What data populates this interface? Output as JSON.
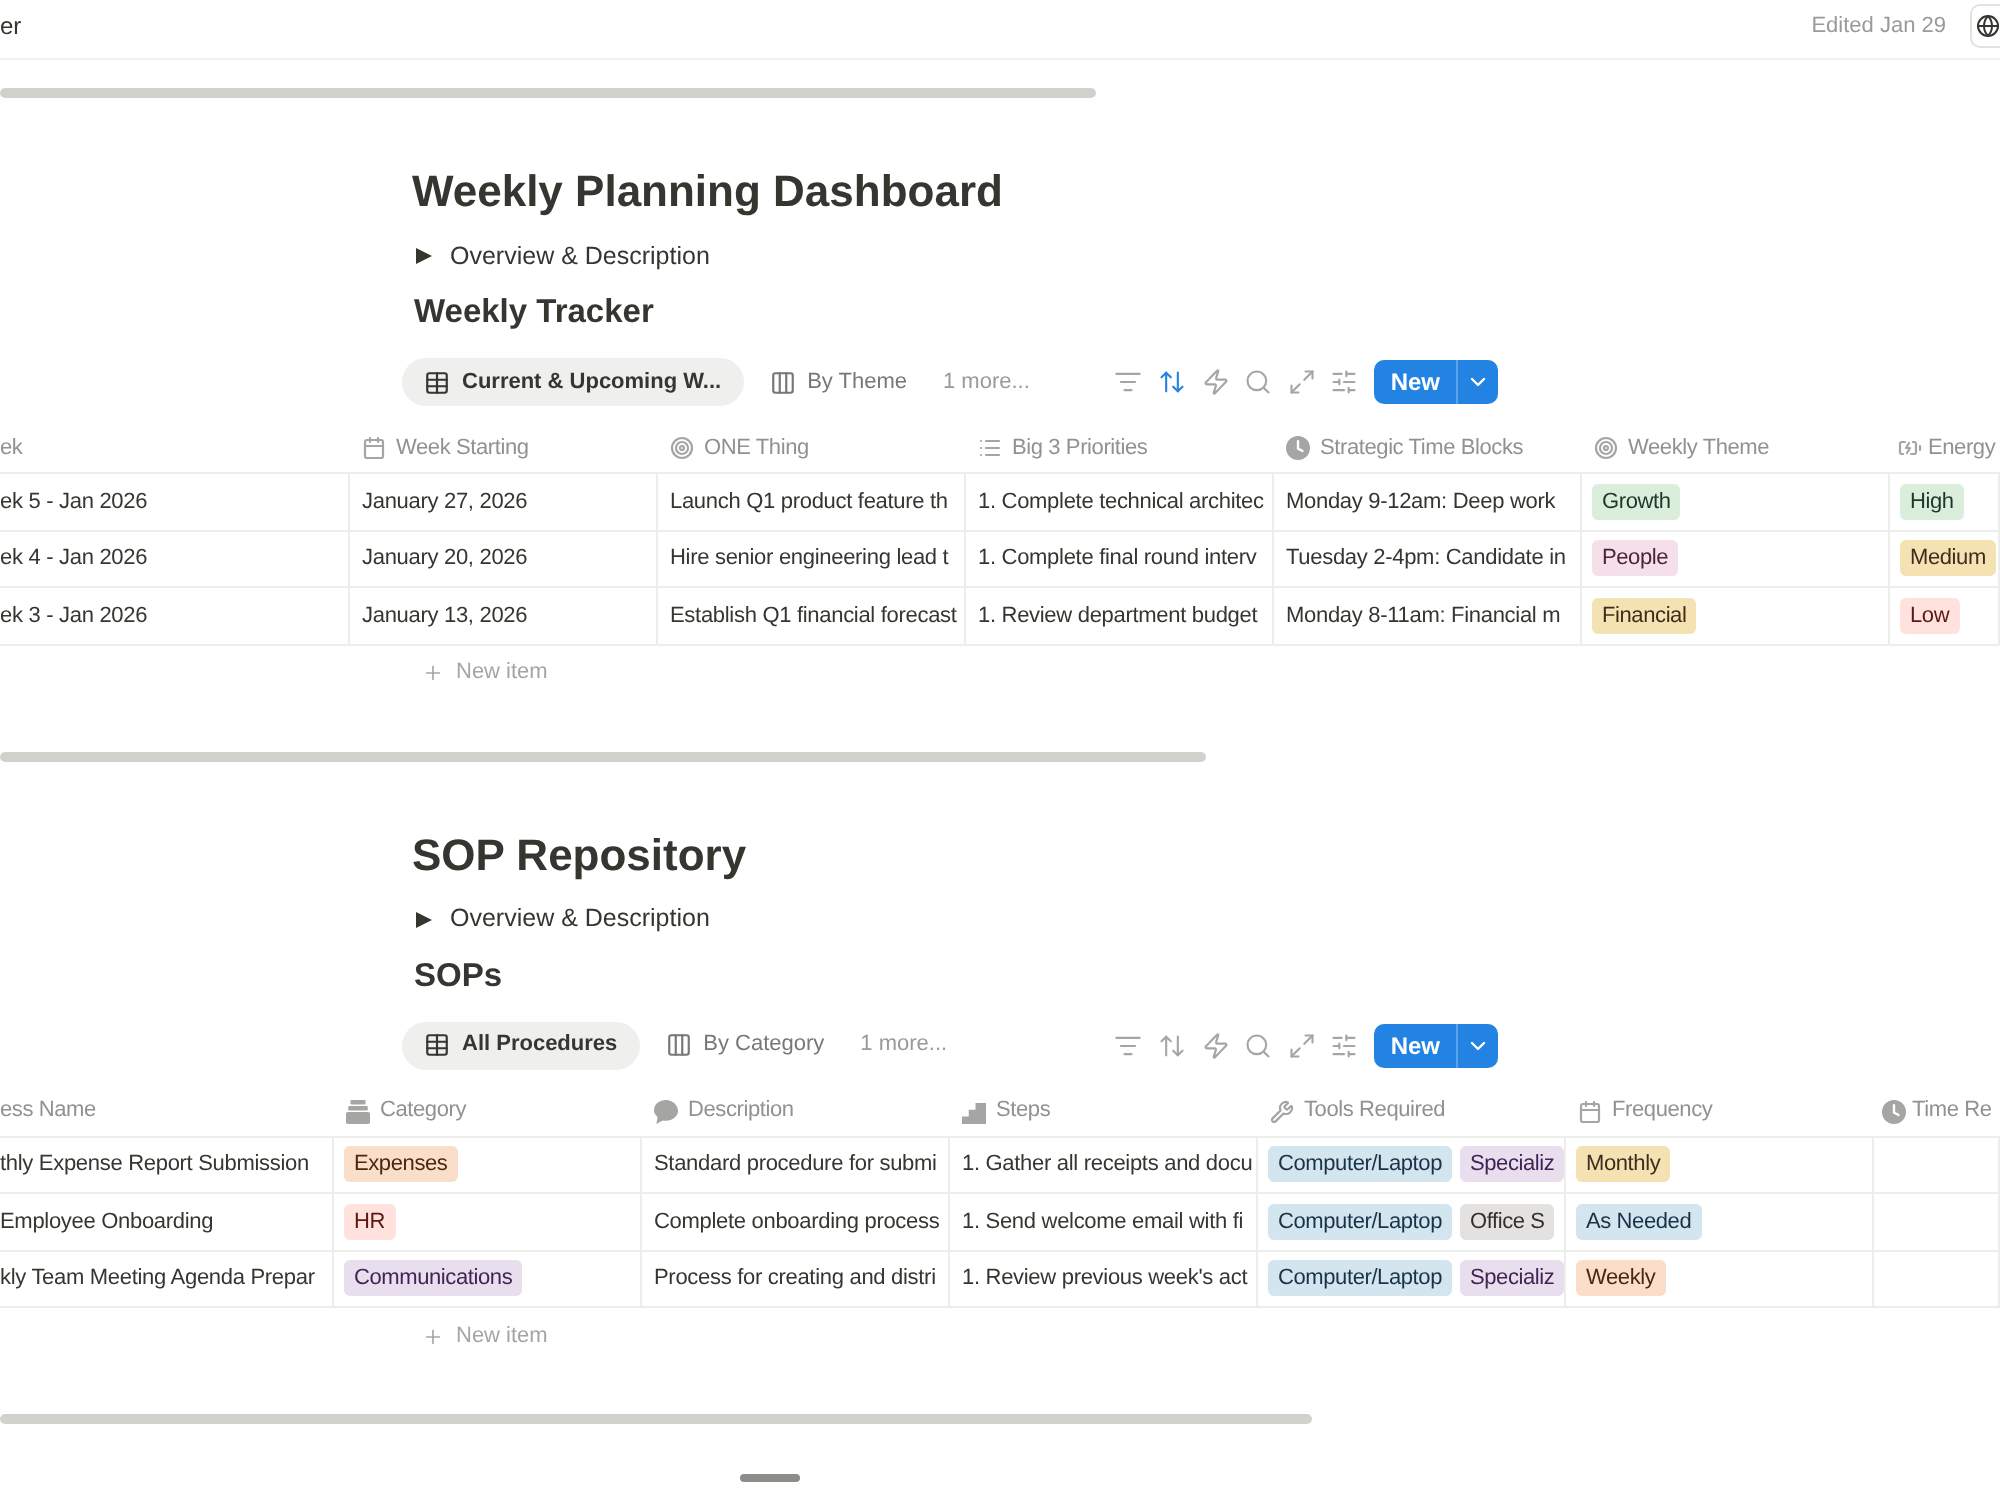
{
  "top_bar": {
    "breadcrumb": "er",
    "edited": "Edited Jan 29"
  },
  "sections": [
    {
      "title": "Weekly Planning Dashboard",
      "toggle": {
        "label": "Overview & Description",
        "expanded": false
      },
      "database_title": "Weekly Tracker",
      "views": [
        {
          "label": "Current & Upcoming W...",
          "kind": "table",
          "selected": true
        },
        {
          "label": "By Theme",
          "kind": "board",
          "selected": false
        }
      ],
      "more_views": "1 more...",
      "toolbar": {
        "sort_active": true,
        "new_button": "New"
      },
      "columns": [
        {
          "label": "ek",
          "kind": "title"
        },
        {
          "label": "Week Starting",
          "kind": "date"
        },
        {
          "label": "ONE Thing",
          "kind": "focus"
        },
        {
          "label": "Big 3 Priorities",
          "kind": "list"
        },
        {
          "label": "Strategic Time Blocks",
          "kind": "time"
        },
        {
          "label": "Weekly Theme",
          "kind": "focus"
        },
        {
          "label": "Energy",
          "kind": "energy"
        }
      ],
      "rows": [
        [
          {
            "text": "ek 5 - Jan 2026"
          },
          {
            "text": "January 27, 2026"
          },
          {
            "text": "Launch Q1 product feature th"
          },
          {
            "text": "1. Complete technical architec"
          },
          {
            "text": "Monday 9-12am: Deep work"
          },
          {
            "tags": [
              {
                "label": "Growth",
                "color": "#dbeddb"
              }
            ]
          },
          {
            "tags": [
              {
                "label": "High",
                "color": "#dbeddb"
              }
            ]
          }
        ],
        [
          {
            "text": "ek 4 - Jan 2026"
          },
          {
            "text": "January 20, 2026"
          },
          {
            "text": "Hire senior engineering lead t"
          },
          {
            "text": "1. Complete final round interv"
          },
          {
            "text": "Tuesday 2-4pm: Candidate in"
          },
          {
            "tags": [
              {
                "label": "People",
                "color": "#f5e0e9"
              }
            ]
          },
          {
            "tags": [
              {
                "label": "Medium",
                "color": "#f5e2b3"
              }
            ]
          }
        ],
        [
          {
            "text": "ek 3 - Jan 2026"
          },
          {
            "text": "January 13, 2026"
          },
          {
            "text": "Establish Q1 financial forecast"
          },
          {
            "text": "1. Review department budget"
          },
          {
            "text": "Monday 8-11am: Financial m"
          },
          {
            "tags": [
              {
                "label": "Financial",
                "color": "#f5e2b3"
              }
            ]
          },
          {
            "tags": [
              {
                "label": "Low",
                "color": "#ffe2dd"
              }
            ]
          }
        ]
      ],
      "new_item": "New item"
    },
    {
      "title": "SOP Repository",
      "toggle": {
        "label": "Overview & Description",
        "expanded": false
      },
      "database_title": "SOPs",
      "views": [
        {
          "label": "All Procedures",
          "kind": "table",
          "selected": true
        },
        {
          "label": "By Category",
          "kind": "board",
          "selected": false
        }
      ],
      "more_views": "1 more...",
      "toolbar": {
        "sort_active": false,
        "new_button": "New"
      },
      "columns": [
        {
          "label": "ess Name",
          "kind": "title"
        },
        {
          "label": "Category",
          "kind": "category"
        },
        {
          "label": "Description",
          "kind": "description"
        },
        {
          "label": "Steps",
          "kind": "steps"
        },
        {
          "label": "Tools Required",
          "kind": "tools"
        },
        {
          "label": "Frequency",
          "kind": "date"
        },
        {
          "label": "Time Re",
          "kind": "time"
        }
      ],
      "rows": [
        [
          {
            "text": "thly Expense Report Submission"
          },
          {
            "tags": [
              {
                "label": "Expenses",
                "color": "#fadec9"
              }
            ]
          },
          {
            "text": "Standard procedure for submi"
          },
          {
            "text": "1. Gather all receipts and docu"
          },
          {
            "tags": [
              {
                "label": "Computer/Laptop",
                "color": "#d3e5ef"
              },
              {
                "label": "Specializ",
                "color": "#e8deee"
              }
            ]
          },
          {
            "tags": [
              {
                "label": "Monthly",
                "color": "#f5e2b3"
              }
            ]
          }
        ],
        [
          {
            "text": "Employee Onboarding"
          },
          {
            "tags": [
              {
                "label": "HR",
                "color": "#ffe2dd"
              }
            ]
          },
          {
            "text": "Complete onboarding process"
          },
          {
            "text": "1. Send welcome email with fi"
          },
          {
            "tags": [
              {
                "label": "Computer/Laptop",
                "color": "#d3e5ef"
              },
              {
                "label": "Office S",
                "color": "#e3e2e0"
              }
            ]
          },
          {
            "tags": [
              {
                "label": "As Needed",
                "color": "#d3e5ef"
              }
            ]
          }
        ],
        [
          {
            "text": "kly Team Meeting Agenda Prepar"
          },
          {
            "tags": [
              {
                "label": "Communications",
                "color": "#e8deee"
              }
            ]
          },
          {
            "text": "Process for creating and distri"
          },
          {
            "text": "1. Review previous week's act"
          },
          {
            "tags": [
              {
                "label": "Computer/Laptop",
                "color": "#d3e5ef"
              },
              {
                "label": "Specializ",
                "color": "#e8deee"
              }
            ]
          },
          {
            "tags": [
              {
                "label": "Weekly",
                "color": "#fadec9"
              }
            ]
          }
        ]
      ],
      "new_item": "New item"
    }
  ]
}
